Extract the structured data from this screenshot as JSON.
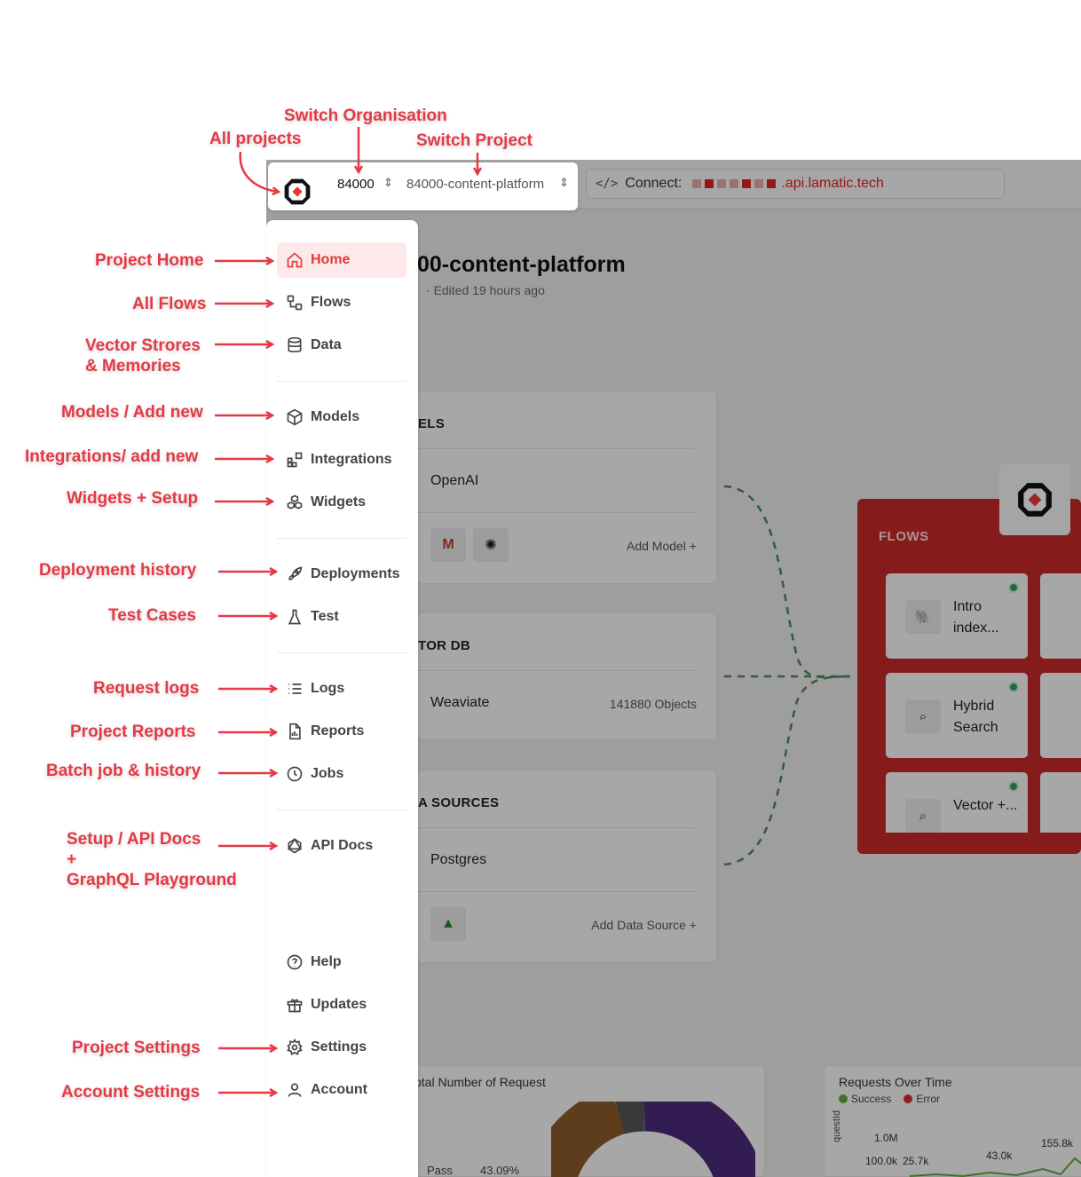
{
  "switcher": {
    "org": "84000",
    "project": "84000-content-platform"
  },
  "topbar": {
    "connect_label": "Connect:",
    "connect_url": ".api.lamatic.tech"
  },
  "project": {
    "title_visible": "00-content-platform",
    "subtitle": "Edited 19 hours ago"
  },
  "cards": {
    "models": {
      "header": "ELS",
      "item": "OpenAI",
      "action": "Add Model"
    },
    "vector": {
      "header": "TOR DB",
      "item": "Weaviate",
      "count": "141880 Objects"
    },
    "sources": {
      "header": "A SOURCES",
      "item": "Postgres",
      "action": "Add Data Source"
    }
  },
  "flows": {
    "label": "FLOWS",
    "items": [
      {
        "name": "Intro index..."
      },
      {
        "name": "Hybrid Search"
      },
      {
        "name": "Vector +..."
      }
    ]
  },
  "stats": {
    "left_title": "otal Number of Request",
    "left_legend": "Pass",
    "left_pct": "43.09%",
    "right_title": "Requests Over Time",
    "legend_success": "Success",
    "legend_error": "Error",
    "ticks": [
      "1.0M",
      "100.0k",
      "25.7k",
      "43.0k",
      "155.8k"
    ],
    "axis": "questId"
  },
  "sidebar": {
    "items": [
      {
        "label": "Home",
        "icon": "home-icon"
      },
      {
        "label": "Flows",
        "icon": "flows-icon"
      },
      {
        "label": "Data",
        "icon": "database-icon"
      },
      {
        "label": "Models",
        "icon": "cube-icon"
      },
      {
        "label": "Integrations",
        "icon": "integrations-icon"
      },
      {
        "label": "Widgets",
        "icon": "widgets-icon"
      },
      {
        "label": "Deployments",
        "icon": "rocket-icon"
      },
      {
        "label": "Test",
        "icon": "flask-icon"
      },
      {
        "label": "Logs",
        "icon": "list-icon"
      },
      {
        "label": "Reports",
        "icon": "report-icon"
      },
      {
        "label": "Jobs",
        "icon": "clock-icon"
      },
      {
        "label": "API Docs",
        "icon": "graphql-icon"
      },
      {
        "label": "Help",
        "icon": "help-icon"
      },
      {
        "label": "Updates",
        "icon": "gift-icon"
      },
      {
        "label": "Settings",
        "icon": "gear-icon"
      },
      {
        "label": "Account",
        "icon": "user-icon"
      }
    ]
  },
  "annotations": {
    "all_projects": "All projects",
    "switch_org": "Switch Organisation",
    "switch_project": "Switch Project",
    "project_home": "Project Home",
    "all_flows": "All Flows",
    "vector_line1": "Vector Strores",
    "vector_line2": "& Memories",
    "models": "Models / Add new",
    "integrations": "Integrations/ add new",
    "widgets": "Widgets + Setup",
    "deployment": "Deployment history",
    "test_cases": "Test Cases",
    "request_logs": "Request logs",
    "project_reports": "Project Reports",
    "batch_jobs": "Batch job & history",
    "api_line1": "Setup / API Docs",
    "api_line2": "+",
    "api_line3": "GraphQL Playground",
    "project_settings": "Project Settings",
    "account_settings": "Account Settings"
  },
  "colors": {
    "accent": "#e53935",
    "annotation": "#e53945",
    "flows_panel": "#c62828"
  }
}
